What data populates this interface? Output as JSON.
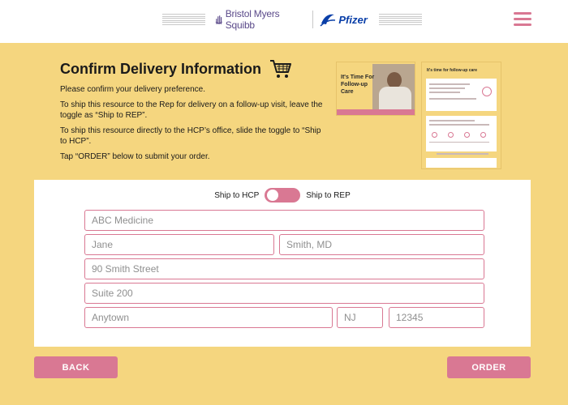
{
  "header": {
    "brand_bms": "Bristol Myers Squibb",
    "brand_pfizer": "Pfizer",
    "menu_icon": "hamburger-menu-icon"
  },
  "intro": {
    "title": "Confirm Delivery Information",
    "title_icon": "shopping-cart-icon",
    "paragraphs": [
      "Please confirm your delivery preference.",
      "To ship this resource to the Rep for delivery on a follow-up visit, leave the toggle as “Ship to REP”.",
      "To ship this resource directly to the HCP’s office, slide the toggle to “Ship to HCP”.",
      "Tap “ORDER” below to submit your order."
    ]
  },
  "preview": {
    "brochure_title": "It's Time For Follow-up Care",
    "sheet_title": "It's time for follow-up care"
  },
  "form": {
    "toggle_left_label": "Ship to HCP",
    "toggle_right_label": "Ship to REP",
    "toggle_state": "Ship to REP",
    "practice_placeholder": "ABC Medicine",
    "first_name_placeholder": "Jane",
    "last_name_placeholder": "Smith, MD",
    "address1_placeholder": "90 Smith Street",
    "address2_placeholder": "Suite 200",
    "city_placeholder": "Anytown",
    "state_placeholder": "NJ",
    "zip_placeholder": "12345"
  },
  "actions": {
    "back_label": "BACK",
    "order_label": "ORDER"
  },
  "colors": {
    "background": "#f5d67f",
    "accent": "#d97893",
    "panel": "#ffffff"
  }
}
